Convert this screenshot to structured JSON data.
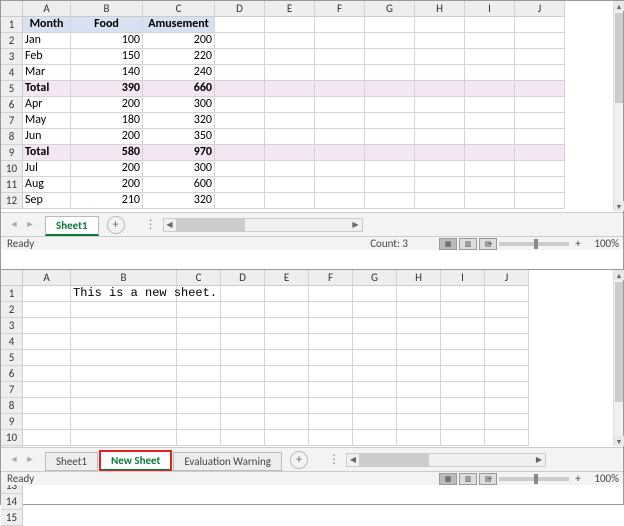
{
  "colors": {
    "accent_green": "#0a7a3b",
    "highlight_red": "#d22",
    "header_blue": "#d6e1f1",
    "total_lavender": "#f4e6f2"
  },
  "top": {
    "columns": [
      "A",
      "B",
      "C",
      "D",
      "E",
      "F",
      "G",
      "H",
      "I",
      "J"
    ],
    "row_count": 12,
    "header": {
      "A": "Month",
      "B": "Food",
      "C": "Amusement"
    },
    "rows": [
      {
        "A": "Jan",
        "B": 100,
        "C": 200,
        "total": false
      },
      {
        "A": "Feb",
        "B": 150,
        "C": 220,
        "total": false
      },
      {
        "A": "Mar",
        "B": 140,
        "C": 240,
        "total": false
      },
      {
        "A": "Total",
        "B": 390,
        "C": 660,
        "total": true
      },
      {
        "A": "Apr",
        "B": 200,
        "C": 300,
        "total": false
      },
      {
        "A": "May",
        "B": 180,
        "C": 320,
        "total": false
      },
      {
        "A": "Jun",
        "B": 200,
        "C": 350,
        "total": false
      },
      {
        "A": "Total",
        "B": 580,
        "C": 970,
        "total": true
      },
      {
        "A": "Jul",
        "B": 200,
        "C": 300,
        "total": false
      },
      {
        "A": "Aug",
        "B": 200,
        "C": 600,
        "total": false
      },
      {
        "A": "Sep",
        "B": 210,
        "C": 320,
        "total": false
      }
    ],
    "tabs": [
      {
        "label": "Sheet1",
        "active": true
      }
    ],
    "status": {
      "ready": "Ready",
      "extra": "Count: 3",
      "zoom": "100%"
    }
  },
  "bottom": {
    "columns": [
      "A",
      "B",
      "C",
      "D",
      "E",
      "F",
      "G",
      "H",
      "I",
      "J"
    ],
    "row_count": 15,
    "cells": {
      "B1": "This is a new sheet."
    },
    "tabs": [
      {
        "label": "Sheet1",
        "active": false
      },
      {
        "label": "New Sheet",
        "active": true,
        "highlight": true
      },
      {
        "label": "Evaluation Warning",
        "active": false
      }
    ],
    "status": {
      "ready": "Ready",
      "zoom": "100%"
    }
  }
}
